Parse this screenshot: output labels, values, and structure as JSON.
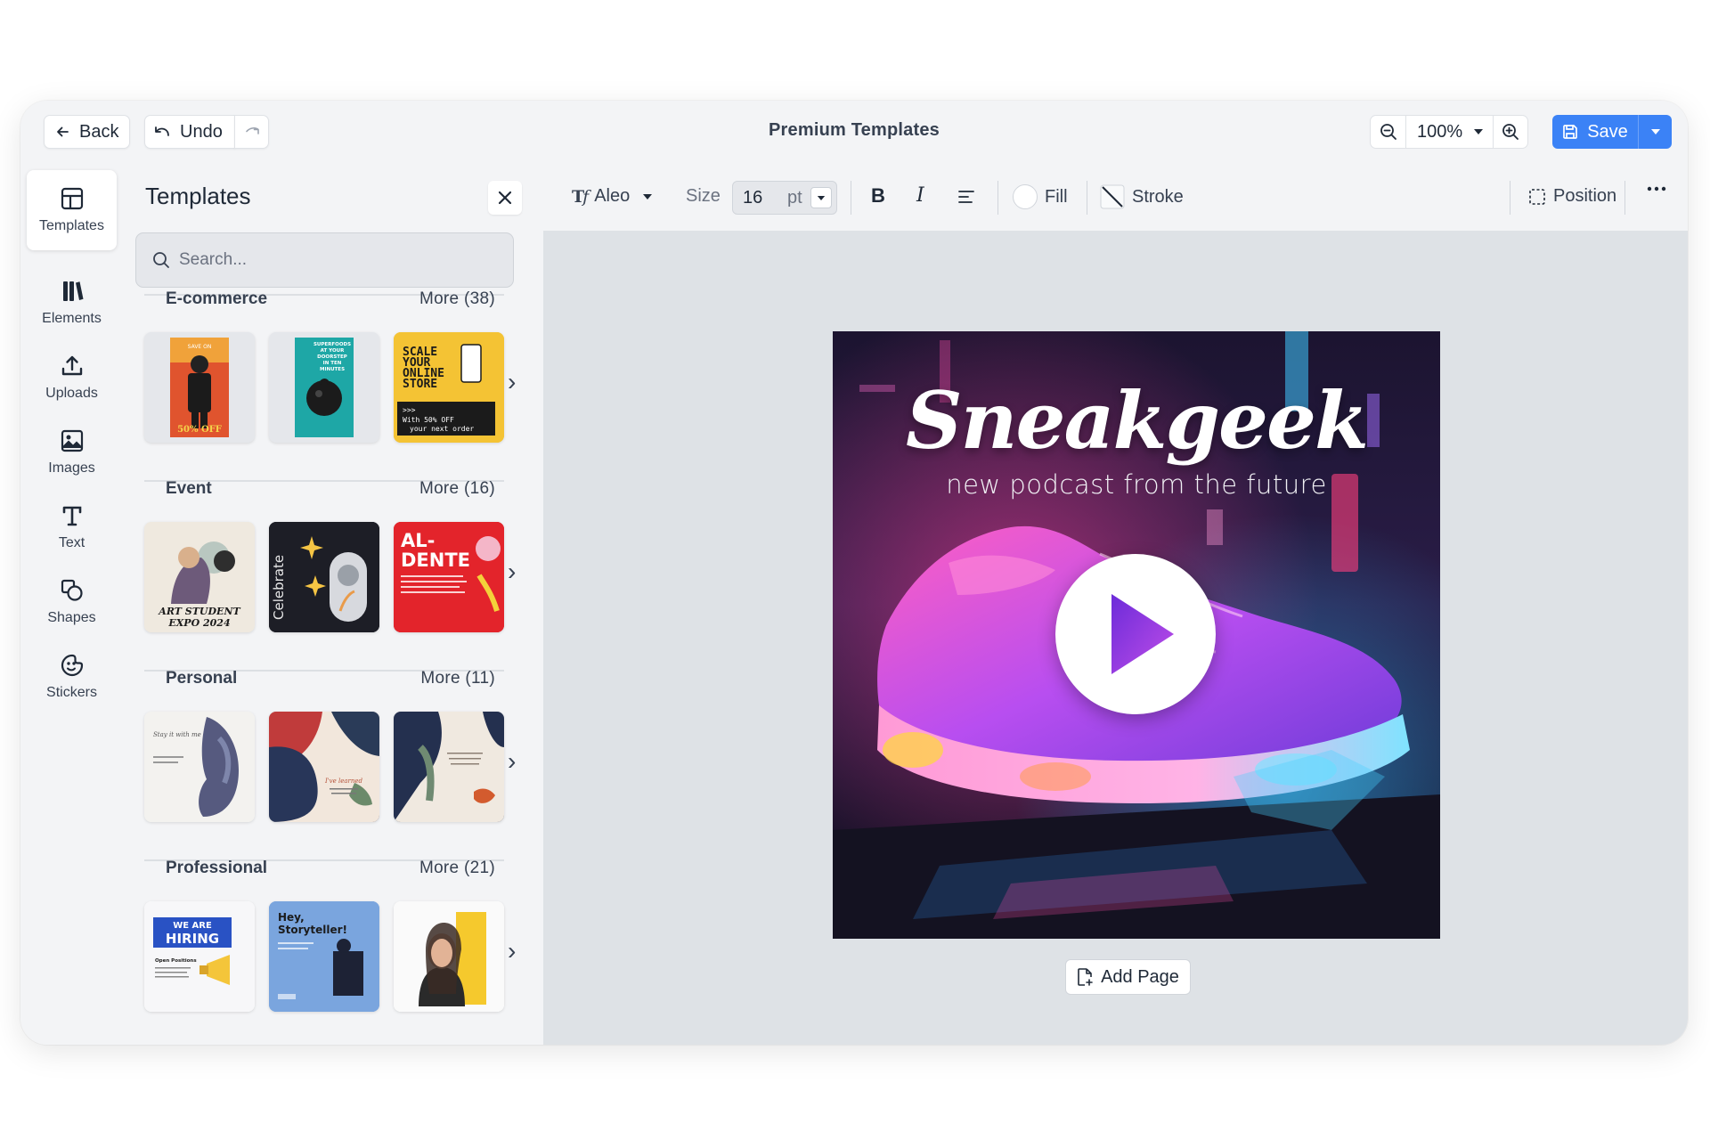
{
  "topbar": {
    "back_label": "Back",
    "undo_label": "Undo",
    "title": "Premium Templates",
    "zoom_value": "100%",
    "save_label": "Save"
  },
  "rail": {
    "items": [
      {
        "label": "Templates",
        "icon": "layout-icon"
      },
      {
        "label": "Elements",
        "icon": "elements-icon"
      },
      {
        "label": "Uploads",
        "icon": "upload-icon"
      },
      {
        "label": "Images",
        "icon": "image-icon"
      },
      {
        "label": "Text",
        "icon": "text-icon"
      },
      {
        "label": "Shapes",
        "icon": "shapes-icon"
      },
      {
        "label": "Stickers",
        "icon": "sticker-icon"
      }
    ]
  },
  "panel": {
    "title": "Templates",
    "search_placeholder": "Search...",
    "categories": [
      {
        "name": "E-commerce",
        "more": "More (38)",
        "thumbs": [
          {
            "lines": [
              "SAVE ON",
              "50% OFF"
            ]
          },
          {
            "lines": [
              "SUPERFOODS",
              "AT YOUR",
              "DOORSTEP",
              "IN TEN",
              "MINUTES"
            ]
          },
          {
            "lines": [
              "SCALE",
              "YOUR",
              "ONLINE",
              "STORE",
              ">>>",
              "With 50% OFF",
              "your next order"
            ]
          }
        ]
      },
      {
        "name": "Event",
        "more": "More (16)",
        "thumbs": [
          {
            "lines": [
              "ART STUDENT",
              "EXPO 2024"
            ]
          },
          {
            "lines": [
              "Celebrate"
            ]
          },
          {
            "lines": [
              "AL-",
              "DENTE"
            ]
          }
        ]
      },
      {
        "name": "Personal",
        "more": "More (11)",
        "thumbs": [
          {
            "lines": [
              "Stay it with me"
            ]
          },
          {
            "lines": [
              "I've learned"
            ]
          },
          {
            "lines": []
          }
        ]
      },
      {
        "name": "Professional",
        "more": "More (21)",
        "thumbs": [
          {
            "lines": [
              "WE ARE",
              "HIRING",
              "Open Positions"
            ]
          },
          {
            "lines": [
              "Hey,",
              "Storyteller!"
            ]
          },
          {
            "lines": []
          }
        ]
      }
    ]
  },
  "toolbar": {
    "font_name": "Aleo",
    "size_label": "Size",
    "size_value": "16",
    "size_unit": "pt",
    "fill_label": "Fill",
    "stroke_label": "Stroke",
    "position_label": "Position"
  },
  "canvas": {
    "title": "Sneakgeek",
    "subtitle": "new podcast from the future",
    "add_page_label": "Add Page"
  },
  "colors": {
    "accent": "#3b82f6",
    "panel_bg": "#f3f4f6",
    "canvas_bg": "#dee2e6",
    "play_triangle": "#a63fe0"
  }
}
